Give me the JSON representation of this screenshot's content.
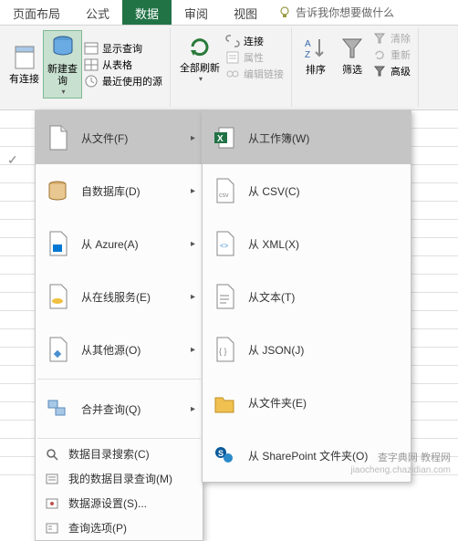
{
  "tabs": {
    "page_layout": "页面布局",
    "formulas": "公式",
    "data": "数据",
    "review": "审阅",
    "view": "视图",
    "tell_me": "告诉我你想要做什么"
  },
  "ribbon": {
    "existing_conn_label": "有连接",
    "new_query_label": "新建查\n询",
    "show_queries": "显示查询",
    "from_table": "从表格",
    "recent_sources": "最近使用的源",
    "refresh_all": "全部刷新",
    "connections": "连接",
    "properties": "属性",
    "edit_links": "编辑链接",
    "sort": "排序",
    "filter": "筛选",
    "clear": "清除",
    "reapply": "重新",
    "advanced": "高级"
  },
  "menu1": {
    "from_file": "从文件(F)",
    "from_db": "自数据库(D)",
    "from_azure": "从 Azure(A)",
    "from_online": "从在线服务(E)",
    "from_other": "从其他源(O)",
    "combine_queries": "合并查询(Q)",
    "catalog_search": "数据目录搜索(C)",
    "my_catalog": "我的数据目录查询(M)",
    "source_settings": "数据源设置(S)...",
    "query_options": "查询选项(P)"
  },
  "menu2": {
    "from_workbook": "从工作簿(W)",
    "from_csv": "从 CSV(C)",
    "from_xml": "从 XML(X)",
    "from_text": "从文本(T)",
    "from_json": "从 JSON(J)",
    "from_folder": "从文件夹(E)",
    "from_sharepoint": "从 SharePoint 文件夹(O)"
  },
  "watermark": {
    "line1": "查字典网 教程网",
    "line2": "jiaocheng.chazidian.com"
  }
}
